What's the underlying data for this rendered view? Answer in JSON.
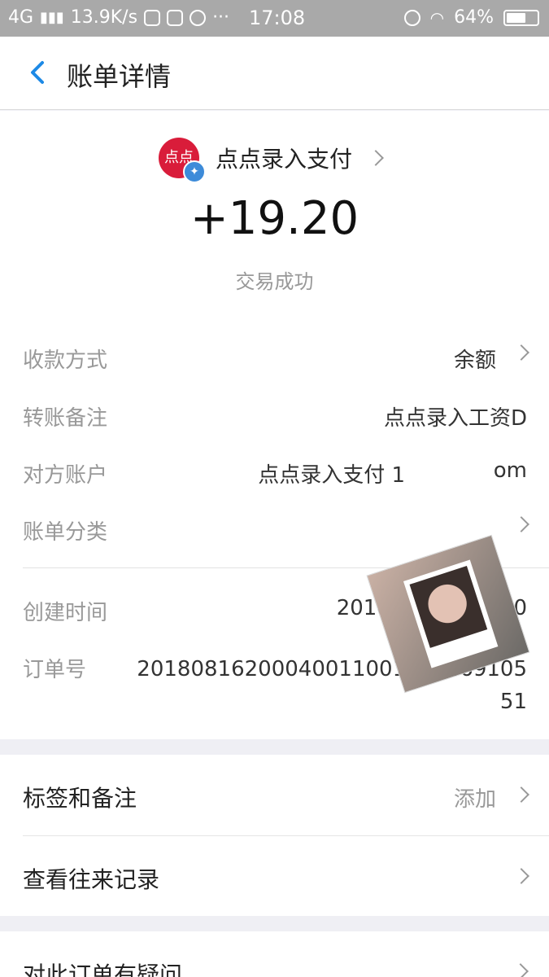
{
  "status_bar": {
    "network": "4G",
    "speed": "13.9K/s",
    "more": "···",
    "time": "17:08",
    "battery": "64%",
    "battery_level": 0.64
  },
  "header": {
    "title": "账单详情"
  },
  "merchant": {
    "logo_text": "点点",
    "name": "点点录入支付"
  },
  "amount": "+19.20",
  "status": "交易成功",
  "details": [
    {
      "label": "收款方式",
      "value": "余额"
    },
    {
      "label": "转账备注",
      "value": "点点录入工资D"
    },
    {
      "label": "对方账户",
      "value": "点点录入支付 1"
    },
    {
      "label": "账单分类",
      "value": ""
    }
  ],
  "account_suffix": "om",
  "created": {
    "label": "创建时间",
    "value": "2018-08-16 16:40"
  },
  "order": {
    "label": "订单号",
    "value": "2018081620004001100140046910551"
  },
  "actions": [
    {
      "label": "标签和备注",
      "side": "添加"
    },
    {
      "label": "查看往来记录",
      "side": ""
    }
  ],
  "question": "对此订单有疑问"
}
